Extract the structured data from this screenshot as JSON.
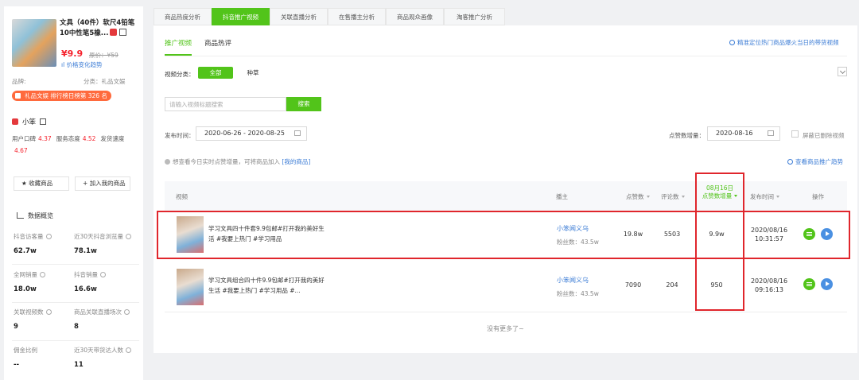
{
  "product": {
    "title": "文具（40件）软尺4铅笔10中性笔5橡...",
    "price": "¥9.9",
    "original_price": "原价：¥59",
    "trend_link": "价格变化趋势",
    "brand_label": "品牌:",
    "category_label": "分类：礼品文娱",
    "rank_badge": "礼品文娱 排行榜日榜第 326 名"
  },
  "shop": {
    "name": "小笨",
    "rating_label": "用户口碑",
    "rating_value": "4.37",
    "service_label": "服务态度",
    "service_value": "4.52",
    "delivery_label": "发货速度",
    "delivery_value": "4.67",
    "collect_btn": "★ 收藏商品",
    "add_btn": "+ 加入我的商品"
  },
  "overview": {
    "title": "数据概览",
    "stats": [
      {
        "label": "抖音访客量",
        "value": "62.7w"
      },
      {
        "label": "近30天抖音浏览量",
        "value": "78.1w"
      },
      {
        "label": "全网销量",
        "value": "18.0w"
      },
      {
        "label": "抖音销量",
        "value": "16.6w"
      },
      {
        "label": "关联视频数",
        "value": "9"
      },
      {
        "label": "商品关联直播场次",
        "value": "8"
      },
      {
        "label": "佣金比例",
        "value": "--"
      },
      {
        "label": "近30天带货达人数",
        "value": "11"
      }
    ]
  },
  "tabs": [
    "商品热度分析",
    "抖音推广视频",
    "关联直播分析",
    "在售播主分析",
    "商品观众画像",
    "淘客推广分析"
  ],
  "subtabs": [
    "推广视频",
    "商品热评"
  ],
  "top_link": "精准定位热门商品爆火当日的带货视频",
  "filter": {
    "category_label": "视频分类：",
    "options": [
      "全部",
      "种草"
    ]
  },
  "search": {
    "placeholder": "请输入视频标题搜索",
    "button": "搜索"
  },
  "date_filter": {
    "publish_label": "发布时间：",
    "publish_range": "2020-06-26 - 2020-08-25",
    "likes_label": "点赞数增量：",
    "likes_date": "2020-08-16",
    "hide_deleted": "屏蔽已删除视频"
  },
  "hint": {
    "text": "想查看今日实时点赞增量，可将商品加入",
    "link": "[我的商品]"
  },
  "trend_link": "查看商品推广趋势",
  "table": {
    "headers": {
      "video": "视频",
      "host": "播主",
      "likes": "点赞数",
      "comments": "评论数",
      "increment_date": "08月16日",
      "increment_label": "点赞数增量",
      "publish": "发布时间",
      "ops": "操作"
    },
    "rows": [
      {
        "title": "学习文具四十件套9.9包邮#打开我的美好生活 #我要上热门 #学习用品",
        "host": "小笨闻义乌",
        "fans": "粉丝数：43.5w",
        "likes": "19.8w",
        "comments": "5503",
        "increment": "9.9w",
        "date": "2020/08/16",
        "time": "10:31:57"
      },
      {
        "title": "学习文具组合四十件9.9包邮#打开我的美好生活 #我要上热门 #学习用品 #...",
        "host": "小笨闻义乌",
        "fans": "粉丝数：43.5w",
        "likes": "7090",
        "comments": "204",
        "increment": "950",
        "date": "2020/08/16",
        "time": "09:16:13"
      }
    ]
  },
  "no_more": "没有更多了~"
}
